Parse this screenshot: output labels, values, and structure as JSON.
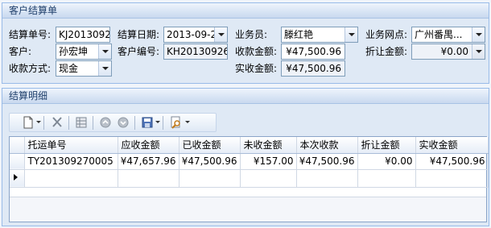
{
  "header_panel": {
    "title": "客户结算单",
    "settlement_no_label": "结算单号:",
    "settlement_no": "KJ2013092",
    "settlement_date_label": "结算日期:",
    "settlement_date": "2013-09-2",
    "salesperson_label": "业务员:",
    "salesperson": "滕红艳",
    "branch_label": "业务网点:",
    "branch": "广州番禺...",
    "customer_label": "客户:",
    "customer": "孙宏坤",
    "customer_no_label": "客户编号:",
    "customer_no": "KH20130926",
    "collect_amount_label": "收款金额:",
    "collect_amount": "¥47,500.96",
    "discount_label": "折让金额:",
    "discount": "¥0.00",
    "payment_method_label": "收款方式:",
    "payment_method": "现金",
    "actual_amount_label": "实收金额:",
    "actual_amount": "¥47,500.96"
  },
  "detail_panel": {
    "title": "结算明细",
    "toolbar": {
      "icons": [
        "new-document-icon",
        "delete-icon",
        "grid-icon",
        "move-up-icon",
        "move-down-icon",
        "save-icon",
        "find-icon"
      ]
    },
    "columns": [
      "托运单号",
      "应收金额",
      "已收金额",
      "未收金额",
      "本次收款",
      "折让金额",
      "实收金额"
    ],
    "rows": [
      [
        "TY201309270005",
        "¥47,657.96",
        "¥47,500.96",
        "¥157.00",
        "¥47,500.96",
        "¥0.00",
        "¥47,500.96"
      ]
    ]
  },
  "colors": {
    "panel_border": "#99bbe8",
    "panel_bg": "#dfe9f5",
    "title_text": "#1f3f6b"
  }
}
